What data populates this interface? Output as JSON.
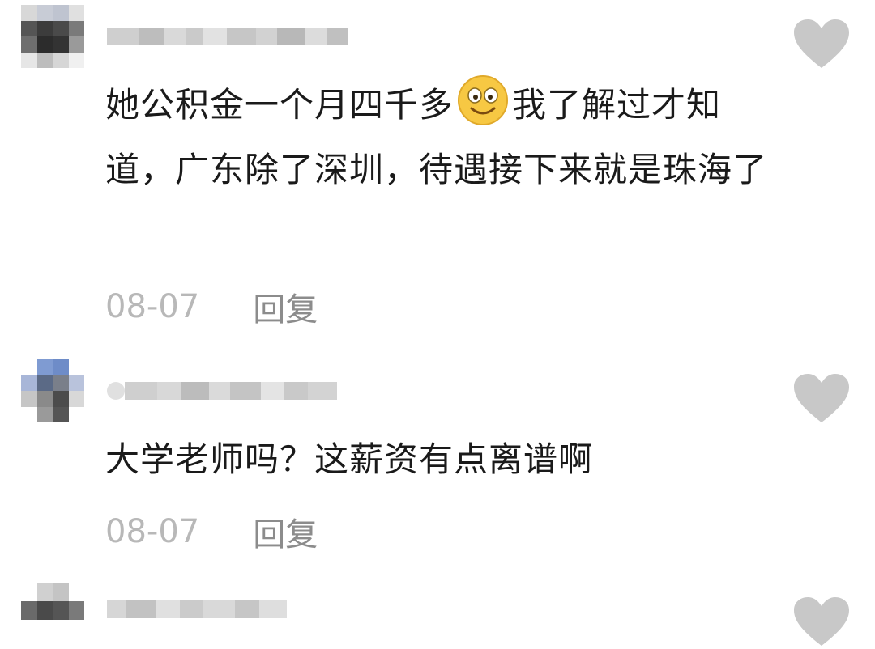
{
  "comments": [
    {
      "text_before_emoji": "她公积金一个月四千多",
      "emoji": "smile-emoji",
      "text_after_emoji": "我了解过才知道，广东除了深圳，待遇接下来就是珠海了",
      "date": "08-07",
      "reply_label": "回复",
      "like_icon": "heart-icon"
    },
    {
      "text": "大学老师吗？这薪资有点离谱啊",
      "date": "08-07",
      "reply_label": "回复",
      "like_icon": "heart-icon"
    }
  ],
  "colors": {
    "text": "#1a1a1a",
    "meta": "#b8b8b8",
    "reply": "#8c8c8c",
    "heart": "#c8c8c8"
  }
}
